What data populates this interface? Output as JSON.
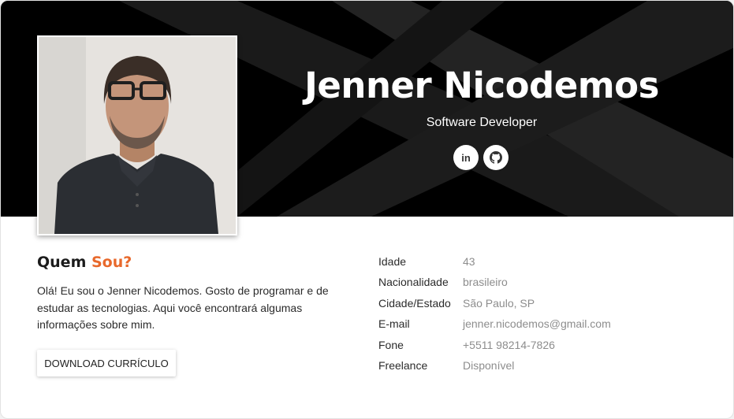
{
  "profile": {
    "name": "Jenner Nicodemos",
    "role": "Software Developer",
    "linkedin_label": "in"
  },
  "about": {
    "title_prefix": "Quem",
    "title_highlight": "Sou?",
    "text": "Olá! Eu sou o Jenner Nicodemos. Gosto de programar e de estudar as tecnologias. Aqui você encontrará algumas informações sobre mim.",
    "download_label": "DOWNLOAD CURRÍCULO"
  },
  "info": [
    {
      "label": "Idade",
      "value": "43"
    },
    {
      "label": "Nacionalidade",
      "value": "brasileiro"
    },
    {
      "label": "Cidade/Estado",
      "value": "São Paulo, SP"
    },
    {
      "label": "E-mail",
      "value": "jenner.nicodemos@gmail.com"
    },
    {
      "label": "Fone",
      "value": "+5511 98214-7826"
    },
    {
      "label": "Freelance",
      "value": "Disponível"
    }
  ],
  "colors": {
    "accent": "#e8692c",
    "hero_bg": "#000000",
    "value_text": "#8d8d8d"
  },
  "icons": {
    "linkedin": "linkedin-icon",
    "github": "github-icon"
  }
}
